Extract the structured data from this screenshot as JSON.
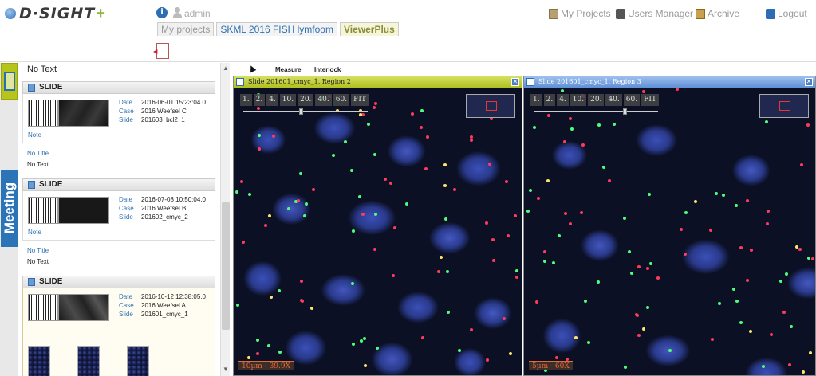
{
  "app": {
    "logo_text": "D·SIGHT",
    "logo_plus": "+"
  },
  "header": {
    "username": "admin",
    "nav": [
      {
        "label": "My Projects",
        "icon": "projects-icon"
      },
      {
        "label": "Users Manager",
        "icon": "users-icon"
      },
      {
        "label": "Archive",
        "icon": "archive-icon"
      },
      {
        "label": "Logout",
        "icon": "logout-icon"
      }
    ]
  },
  "tabs": [
    {
      "label": "My projects"
    },
    {
      "label": "SKML 2016 FISH lymfoom"
    },
    {
      "label": "ViewerPlus"
    }
  ],
  "rail": {
    "meeting_label": "Meeting"
  },
  "slides_list": {
    "top_text": "No Text",
    "cards": [
      {
        "header": "SLIDE",
        "date_label": "Date",
        "date": "2016-06-01 15:23:04.0",
        "case_label": "Case",
        "case": "2016 Weefsel C",
        "slide_label": "Slide",
        "slide": "201603_bcl2_1",
        "note_label": "Note",
        "title_label": "No Title",
        "text": "No Text"
      },
      {
        "header": "SLIDE",
        "date_label": "Date",
        "date": "2016-07-08 10:50:04.0",
        "case_label": "Case",
        "case": "2016 Weefsel B",
        "slide_label": "Slide",
        "slide": "201602_cmyc_2",
        "note_label": "Note",
        "title_label": "No Title",
        "text": "No Text"
      },
      {
        "header": "SLIDE",
        "date_label": "Date",
        "date": "2016-10-12 12:38:05.0",
        "case_label": "Case",
        "case": "2016 Weefsel A",
        "slide_label": "Slide",
        "slide": "201601_cmyc_1"
      }
    ]
  },
  "viewer_toolbar": {
    "measure": "Measure",
    "interlock": "Interlock"
  },
  "viewers": [
    {
      "title": "Slide 201601_cmyc_1,  Region 2",
      "zoom_buttons": [
        "1.",
        "2.",
        "4.",
        "10.",
        "20.",
        "40.",
        "60.",
        "FIT"
      ],
      "scale": "10µm - 39.9X",
      "close": "✕",
      "accent": "#b9c52a"
    },
    {
      "title": "Slide 201601_cmyc_1,  Region 3",
      "zoom_buttons": [
        "1.",
        "2.",
        "4.",
        "10.",
        "20.",
        "40.",
        "60.",
        "FIT"
      ],
      "scale": "5µm - 60X",
      "close": "✕",
      "accent": "#6f9be0"
    }
  ]
}
